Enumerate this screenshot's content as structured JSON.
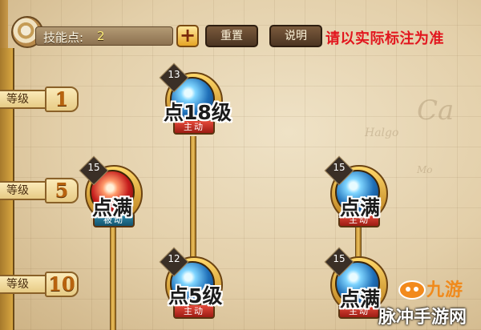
{
  "topbar": {
    "skill_points_label": "技能点:",
    "skill_points_value": "2",
    "add_label": "+",
    "reset_label": "重置",
    "info_label": "说明",
    "notice": "请以实际标注为准"
  },
  "levels": [
    {
      "label": "等级",
      "value": "1"
    },
    {
      "label": "等级",
      "value": "5"
    },
    {
      "label": "等级",
      "value": "10"
    }
  ],
  "skills": [
    {
      "badge": "13",
      "type": "主动",
      "overlay": "点18级",
      "element": "blue"
    },
    {
      "badge": "15",
      "type": "被动",
      "overlay": "点满",
      "element": "red"
    },
    {
      "badge": "15",
      "type": "主动",
      "overlay": "点满",
      "element": "blue"
    },
    {
      "badge": "12",
      "type": "主动",
      "overlay": "点5级",
      "element": "blue"
    },
    {
      "badge": "15",
      "type": "主动",
      "overlay": "点满",
      "element": "blue"
    }
  ],
  "watermark": {
    "brand": "九游",
    "site": "脉冲手游网"
  }
}
